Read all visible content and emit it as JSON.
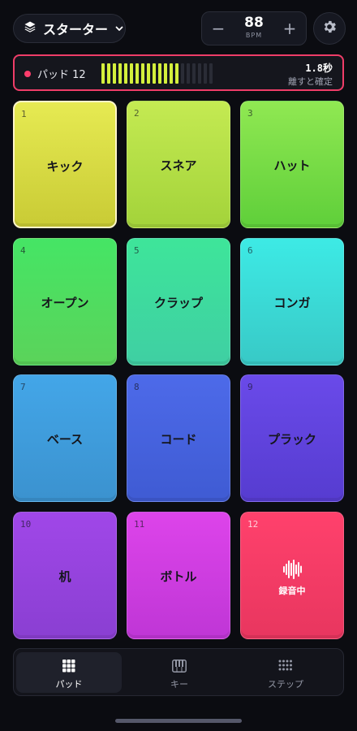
{
  "preset": {
    "label": "スターター",
    "icon": "layers-icon"
  },
  "bpm": {
    "minus": "−",
    "value": "88",
    "unit": "BPM",
    "plus": "+"
  },
  "status": {
    "pad_label": "パッド 12",
    "meter_level": 0.7,
    "meter_segments": 20,
    "meter_active": 14,
    "time": "1.8秒",
    "hint": "離すと確定",
    "accent": "#ef3d68",
    "meter_color": "#d4ef3c"
  },
  "pads": [
    {
      "num": "1",
      "name": "キック",
      "colors": [
        "#e6ea52",
        "#c9cb35"
      ]
    },
    {
      "num": "2",
      "name": "スネア",
      "colors": [
        "#c4ea52",
        "#a3d33a"
      ]
    },
    {
      "num": "3",
      "name": "ハット",
      "colors": [
        "#90e852",
        "#5fcf3a"
      ]
    },
    {
      "num": "4",
      "name": "オープン",
      "colors": [
        "#45e565",
        "#5bd35a"
      ]
    },
    {
      "num": "5",
      "name": "クラップ",
      "colors": [
        "#3ee59a",
        "#3fcfa3"
      ]
    },
    {
      "num": "6",
      "name": "コンガ",
      "colors": [
        "#3deae5",
        "#38c9c6"
      ]
    },
    {
      "num": "7",
      "name": "ベース",
      "colors": [
        "#43a6e8",
        "#3b92cf"
      ]
    },
    {
      "num": "8",
      "name": "コード",
      "colors": [
        "#4d6ae9",
        "#3f5bd3"
      ]
    },
    {
      "num": "9",
      "name": "プラック",
      "colors": [
        "#6a4ae9",
        "#563cd0"
      ]
    },
    {
      "num": "10",
      "name": "机",
      "colors": [
        "#a047e8",
        "#8a3fd2"
      ]
    },
    {
      "num": "11",
      "name": "ボトル",
      "colors": [
        "#dd44ea",
        "#bf36d6"
      ]
    },
    {
      "num": "12",
      "name": "",
      "rec_label": "録音中",
      "icon": "waveform-icon",
      "colors": [
        "#ff416c",
        "#e8365f"
      ]
    }
  ],
  "tabs": [
    {
      "label": "パッド",
      "icon": "grid-icon",
      "active": true
    },
    {
      "label": "キー",
      "icon": "piano-icon",
      "active": false
    },
    {
      "label": "ステップ",
      "icon": "dots-grid-icon",
      "active": false
    }
  ]
}
